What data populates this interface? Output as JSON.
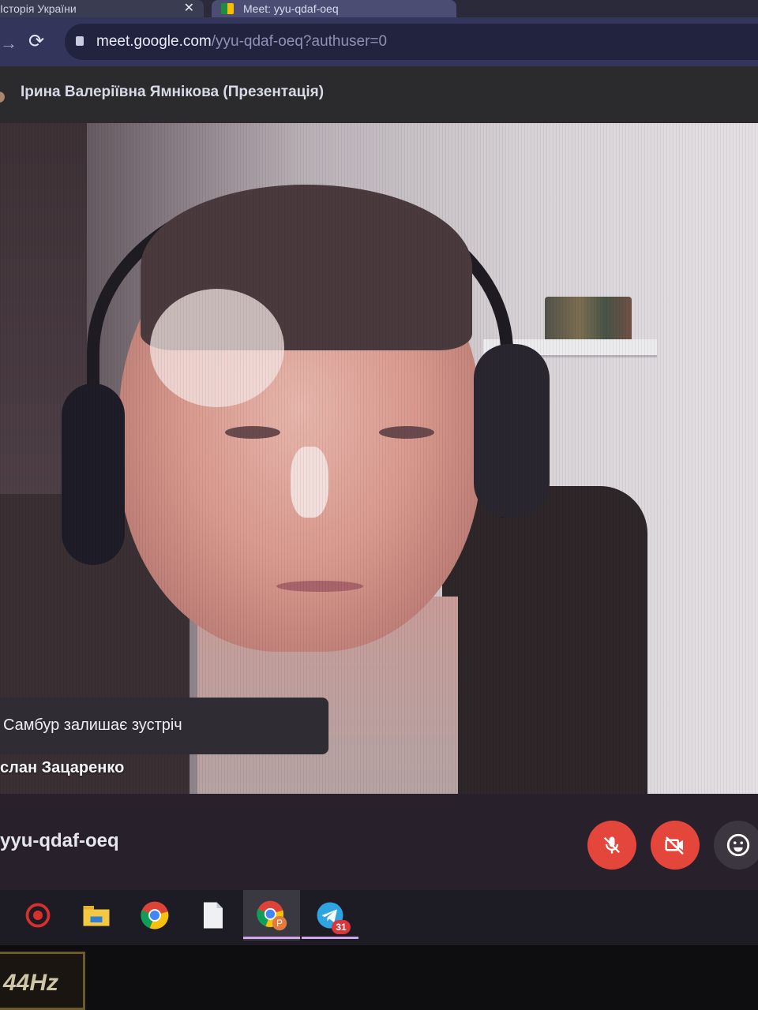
{
  "browser": {
    "tabs": [
      {
        "title": "Історія України",
        "close": "✕"
      },
      {
        "title": "Meet:  yyu-qdaf-oeq"
      }
    ],
    "nav": {
      "forward_glyph": "→",
      "reload_glyph": "⟳"
    },
    "url": {
      "host": "meet.google.com",
      "path": "/yyu-qdaf-oeq?authuser=0"
    }
  },
  "meet": {
    "presenter": "Ірина Валеріївна Ямнікова (Презентація)",
    "toast": "Самбур залишає зустріч",
    "participant_name": "слан Зацаренко",
    "meeting_code": "yyu-qdaf-oeq",
    "controls": {
      "mic": {
        "icon": "mic-off-icon",
        "state": "off",
        "color": "#e5463c"
      },
      "camera": {
        "icon": "videocam-off-icon",
        "state": "off",
        "color": "#e5463c"
      },
      "reactions": {
        "icon": "emoji-icon"
      }
    }
  },
  "taskbar": {
    "items": [
      {
        "name": "app-red-icon"
      },
      {
        "name": "file-explorer-icon"
      },
      {
        "name": "chrome-icon"
      },
      {
        "name": "document-icon"
      },
      {
        "name": "chrome-profile-icon",
        "profile_letter": "P",
        "active": true
      },
      {
        "name": "telegram-icon",
        "badge": "31"
      }
    ]
  },
  "monitor": {
    "refresh_label": "44Hz"
  },
  "colors": {
    "accent_red": "#e5463c",
    "taskbar_underline": "#cfa6e8"
  }
}
